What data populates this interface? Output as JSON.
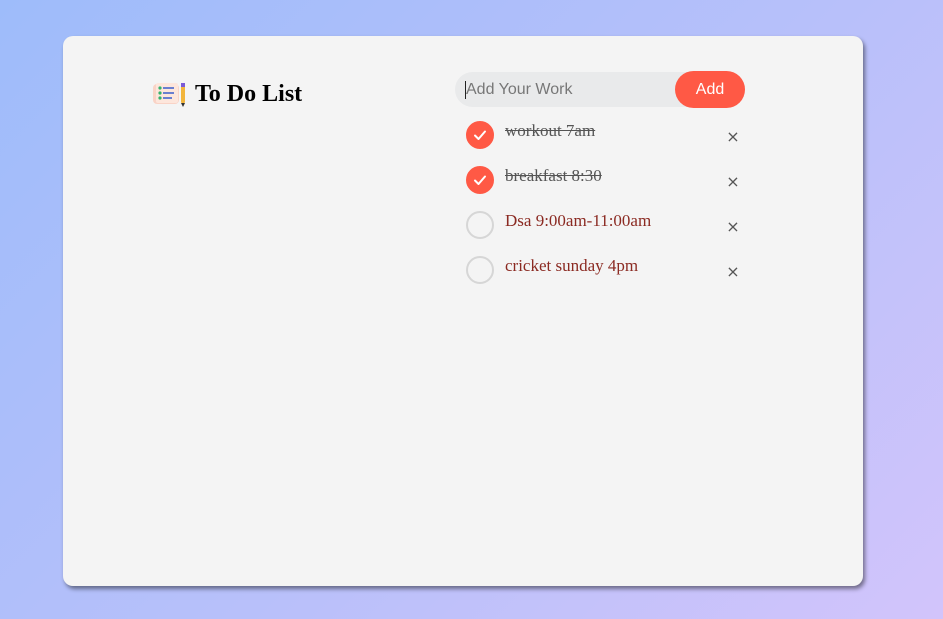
{
  "app": {
    "title": "To Do List",
    "title_icon": "notepad-checklist-icon"
  },
  "input": {
    "placeholder": "Add Your Work",
    "value": "",
    "add_label": "Add"
  },
  "colors": {
    "accent": "#ff5945",
    "card_background": "#f4f4f4",
    "pending_text": "#8b2a22",
    "done_text": "#555555"
  },
  "tasks": [
    {
      "text": "workout 7am",
      "done": true,
      "remove_symbol": "×"
    },
    {
      "text": "breakfast 8:30",
      "done": true,
      "remove_symbol": "×"
    },
    {
      "text": "Dsa 9:00am-11:00am",
      "done": false,
      "remove_symbol": "×"
    },
    {
      "text": "cricket sunday 4pm",
      "done": false,
      "remove_symbol": "×"
    }
  ]
}
